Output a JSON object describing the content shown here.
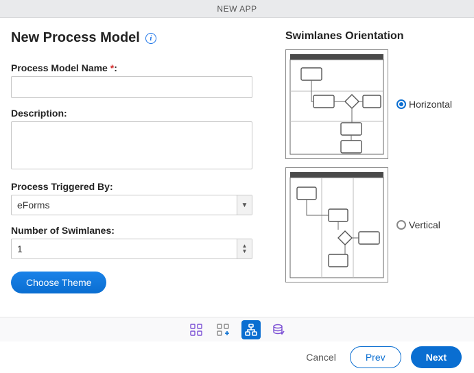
{
  "header": {
    "title": "NEW APP"
  },
  "page": {
    "title": "New Process Model"
  },
  "form": {
    "name": {
      "label": "Process Model Name ",
      "value": ""
    },
    "description": {
      "label": "Description:",
      "value": ""
    },
    "trigger": {
      "label": "Process Triggered By:",
      "value": "eForms"
    },
    "swimlanes": {
      "label": "Number of Swimlanes:",
      "value": "1"
    },
    "theme_btn": "Choose Theme"
  },
  "orientation": {
    "title": "Swimlanes Orientation",
    "options": {
      "horizontal": "Horizontal",
      "vertical": "Vertical"
    },
    "selected": "horizontal"
  },
  "footer": {
    "cancel": "Cancel",
    "prev": "Prev",
    "next": "Next"
  }
}
